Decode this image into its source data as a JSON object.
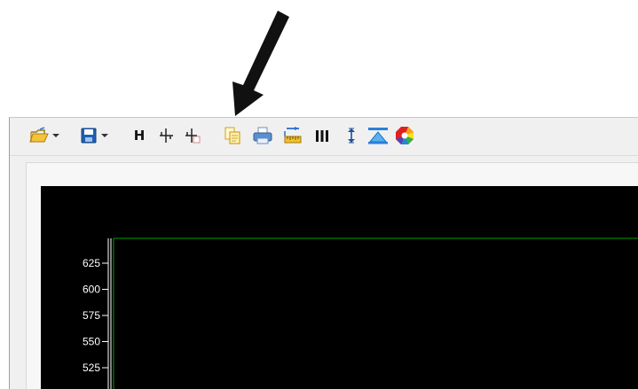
{
  "toolbar": {
    "items": [
      {
        "icon": "open-folder-icon"
      },
      {
        "icon": "dropdown-arrow-icon"
      },
      {
        "icon": "save-disk-icon"
      },
      {
        "icon": "dropdown-arrow-icon"
      },
      {
        "icon": "h-marker-icon",
        "label": "H"
      },
      {
        "icon": "cursor-cross-icon"
      },
      {
        "icon": "cursor-cross-alt-icon"
      },
      {
        "icon": "copy-icon"
      },
      {
        "icon": "print-icon"
      },
      {
        "icon": "ruler-icon"
      },
      {
        "icon": "bars-icon",
        "label": "III"
      },
      {
        "icon": "vertical-resize-icon"
      },
      {
        "icon": "triangle-scale-icon"
      },
      {
        "icon": "color-wheel-icon"
      }
    ]
  },
  "chart_data": {
    "type": "line",
    "title": "",
    "xlabel": "",
    "ylabel": "",
    "y_ticks": [
      "625",
      "600",
      "575",
      "550",
      "525"
    ],
    "y_tick_values": [
      625,
      600,
      575,
      550,
      525
    ],
    "background": "#000000",
    "axis_color": "#ffffff",
    "frame_color": "#00a000",
    "series": []
  },
  "colors": {
    "annotation_arrow": "#111111",
    "toolbar_bg": "#f0f0f0",
    "plot_bg": "#000000",
    "plot_frame": "#00a000"
  }
}
